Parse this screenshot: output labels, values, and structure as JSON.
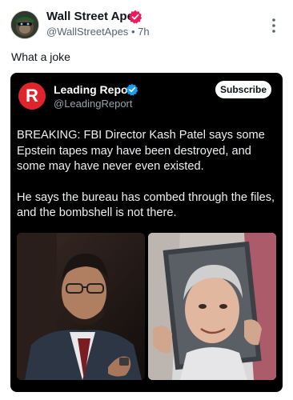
{
  "author": {
    "name": "Wall Street Apes",
    "handle": "@WallStreetApes",
    "time": "7h",
    "separator": "•",
    "badge_color": "#f0185c"
  },
  "post": {
    "text": "What a joke"
  },
  "menu": {
    "icon": "more-vertical-icon"
  },
  "embedded_post": {
    "account_name": "Leading Report",
    "handle": "@LeadingReport",
    "logo_letter": "R",
    "logo_color": "#e0242b",
    "badge_color": "#1d9bf0",
    "subscribe_label": "Subscribe",
    "paragraphs": [
      "BREAKING: FBI Director Kash Patel says some Epstein tapes may have been destroyed, and some may have never even existed.",
      "He says the bureau has combed through the files, and the bombshell is not there."
    ]
  }
}
